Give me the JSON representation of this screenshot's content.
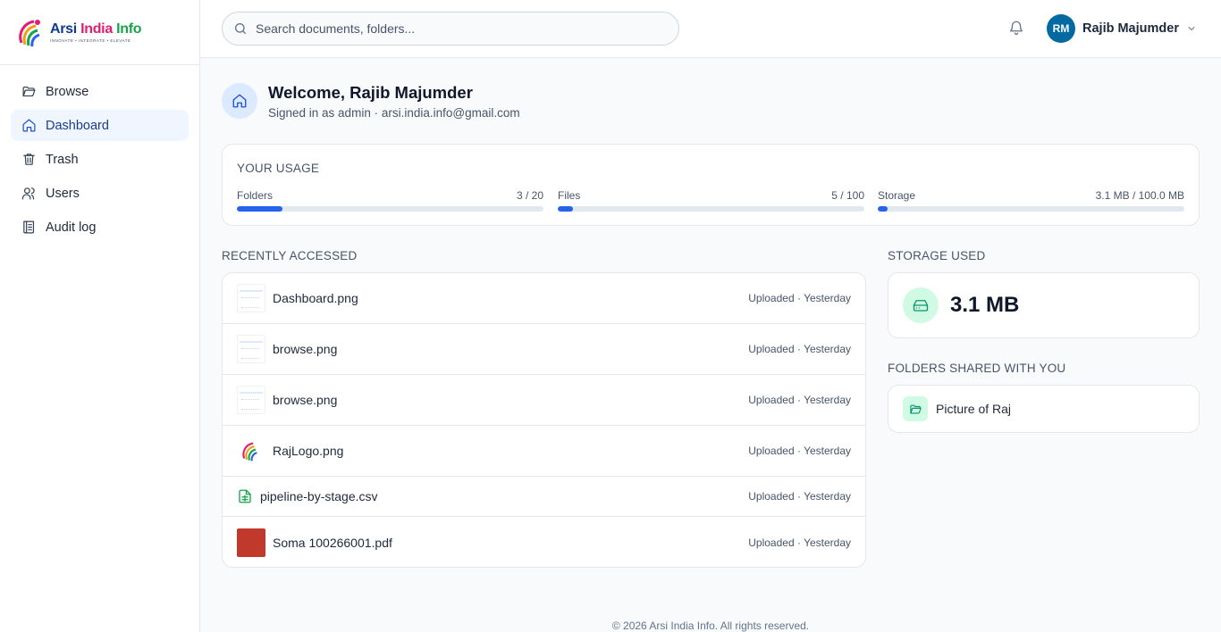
{
  "brand": {
    "name_part1": "Arsi",
    "name_part2": "India",
    "name_part3": "Info",
    "tagline": "INNOVATE • INTEGRATE • ELEVATE"
  },
  "sidebar": {
    "items": [
      {
        "label": "Browse",
        "icon": "folder-open-icon",
        "active": false
      },
      {
        "label": "Dashboard",
        "icon": "home-icon",
        "active": true
      },
      {
        "label": "Trash",
        "icon": "trash-icon",
        "active": false
      },
      {
        "label": "Users",
        "icon": "users-icon",
        "active": false
      },
      {
        "label": "Audit log",
        "icon": "log-icon",
        "active": false
      }
    ]
  },
  "header": {
    "search_placeholder": "Search documents, folders...",
    "user_initials": "RM",
    "user_name": "Rajib Majumder"
  },
  "welcome": {
    "title": "Welcome, Rajib Majumder",
    "subtitle": "Signed in as admin · arsi.india.info@gmail.com"
  },
  "usage": {
    "heading": "YOUR USAGE",
    "meters": [
      {
        "label": "Folders",
        "value": "3 / 20",
        "fraction": 0.15
      },
      {
        "label": "Files",
        "value": "5 / 100",
        "fraction": 0.05
      },
      {
        "label": "Storage",
        "value": "3.1 MB / 100.0 MB",
        "fraction": 0.031
      }
    ]
  },
  "recent": {
    "heading": "RECENTLY ACCESSED",
    "files": [
      {
        "name": "Dashboard.png",
        "meta": "Uploaded · Yesterday",
        "kind": "image"
      },
      {
        "name": "browse.png",
        "meta": "Uploaded · Yesterday",
        "kind": "image"
      },
      {
        "name": "browse.png",
        "meta": "Uploaded · Yesterday",
        "kind": "image"
      },
      {
        "name": "RajLogo.png",
        "meta": "Uploaded · Yesterday",
        "kind": "logo"
      },
      {
        "name": "pipeline-by-stage.csv",
        "meta": "Uploaded · Yesterday",
        "kind": "csv"
      },
      {
        "name": "Soma 100266001.pdf",
        "meta": "Uploaded · Yesterday",
        "kind": "pdf"
      }
    ]
  },
  "storage": {
    "heading": "STORAGE USED",
    "value": "3.1 MB"
  },
  "shared": {
    "heading": "FOLDERS SHARED WITH YOU",
    "folders": [
      {
        "name": "Picture of Raj"
      }
    ]
  },
  "footer": {
    "text": "© 2026 Arsi India Info. All rights reserved."
  },
  "colors": {
    "accent": "#2563eb",
    "avatar": "#0369a1",
    "success": "#059669"
  }
}
